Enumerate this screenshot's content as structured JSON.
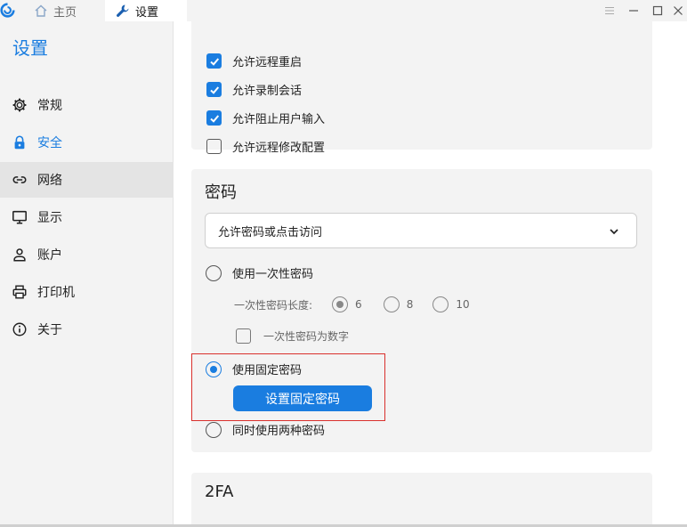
{
  "titlebar": {
    "tabs": [
      {
        "label": "主页",
        "icon": "home-icon"
      },
      {
        "label": "设置",
        "icon": "wrench-icon"
      }
    ]
  },
  "sidebar": {
    "title": "设置",
    "items": [
      {
        "label": "常规",
        "icon": "gear-icon"
      },
      {
        "label": "安全",
        "icon": "lock-icon"
      },
      {
        "label": "网络",
        "icon": "link-icon"
      },
      {
        "label": "显示",
        "icon": "monitor-icon"
      },
      {
        "label": "账户",
        "icon": "user-icon"
      },
      {
        "label": "打印机",
        "icon": "printer-icon"
      },
      {
        "label": "关于",
        "icon": "info-icon"
      }
    ]
  },
  "permissions": {
    "items": [
      {
        "label": "允许远程重启",
        "checked": true
      },
      {
        "label": "允许录制会话",
        "checked": true
      },
      {
        "label": "允许阻止用户输入",
        "checked": true
      },
      {
        "label": "允许远程修改配置",
        "checked": false
      }
    ]
  },
  "password": {
    "title": "密码",
    "access_mode": "允许密码或点击访问",
    "one_time": {
      "label": "使用一次性密码",
      "length_label": "一次性密码长度:",
      "lengths": [
        "6",
        "8",
        "10"
      ],
      "selected_length": "6",
      "numeric_label": "一次性密码为数字"
    },
    "fixed": {
      "label": "使用固定密码",
      "button": "设置固定密码"
    },
    "both_label": "同时使用两种密码",
    "selected": "fixed"
  },
  "twofa": {
    "title": "2FA"
  },
  "colors": {
    "accent": "#1a7de0",
    "highlight": "#d9302c"
  }
}
